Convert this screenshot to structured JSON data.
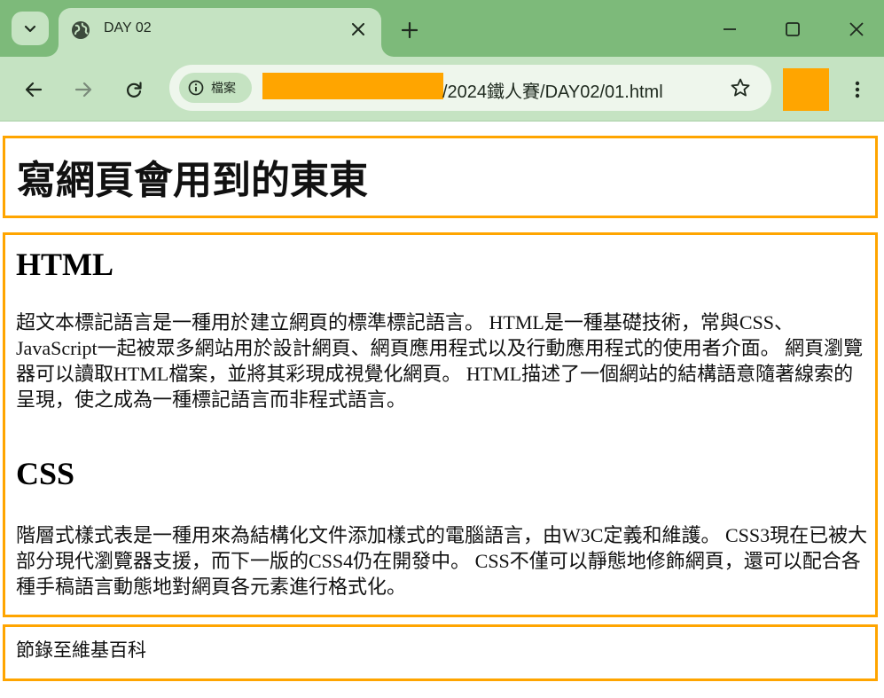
{
  "browser": {
    "tab_title": "DAY 02",
    "site_info_label": "檔案",
    "url_visible": "/2024鐵人賽/DAY02/01.html"
  },
  "page": {
    "title": "寫網頁會用到的東東",
    "sections": [
      {
        "heading": "HTML",
        "body": "超文本標記語言是一種用於建立網頁的標準標記語言。 HTML是一種基礎技術，常與CSS、JavaScript一起被眾多網站用於設計網頁、網頁應用程式以及行動應用程式的使用者介面。 網頁瀏覽器可以讀取HTML檔案，並將其彩現成視覺化網頁。 HTML描述了一個網站的結構語意隨著線索的呈現，使之成為一種標記語言而非程式語言。"
      },
      {
        "heading": "CSS",
        "body": "階層式樣式表是一種用來為結構化文件添加樣式的電腦語言，由W3C定義和維護。 CSS3現在已被大部分現代瀏覽器支援，而下一版的CSS4仍在開發中。 CSS不僅可以靜態地修飾網頁，還可以配合各種手稿語言動態地對網頁各元素進行格式化。"
      }
    ],
    "footer": "節錄至維基百科"
  },
  "colors": {
    "tabstrip": "#7dba7a",
    "toolbar": "#c5e3c2",
    "box_border": "#ffa500",
    "redaction": "#ffa500"
  }
}
